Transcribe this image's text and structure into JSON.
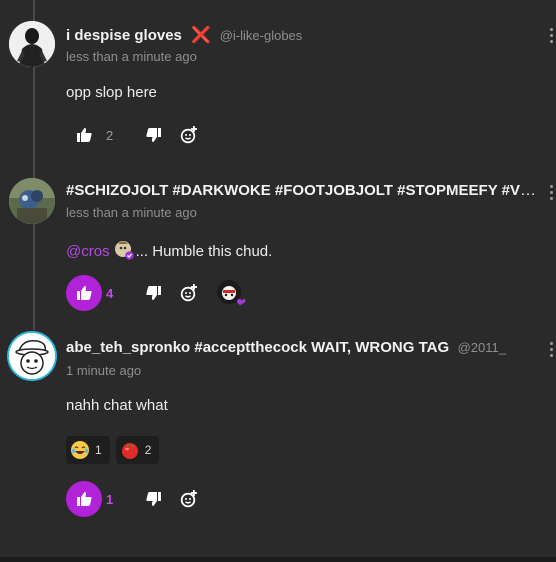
{
  "comments": [
    {
      "display_name": "i despise gloves",
      "badge": "❌",
      "handle": "@i-like-globes",
      "time": "less than a minute ago",
      "text": "opp slop here",
      "like_count": "2",
      "liked": false
    },
    {
      "display_name": "#SCHIZOJOLT #DARKWOKE #FOOTJOBJOLT #STOPMEEFY #VOIDGRASSCAMPAIGN",
      "time": "less than a minute ago",
      "mention": "@cros",
      "text": "... Humble this chud.",
      "like_count": "4",
      "liked": true
    },
    {
      "display_name": "abe_teh_spronko #acceptthecock WAIT, WRONG TAG",
      "handle": "@2011_",
      "time": "1 minute ago",
      "text": "nahh chat what",
      "reactions": [
        {
          "emoji": "😂",
          "count": "1"
        },
        {
          "emoji": "🍅",
          "count": "2"
        }
      ],
      "like_count": "1",
      "liked": true
    }
  ],
  "icons": {
    "like": "thumbs-up-icon",
    "dislike": "thumbs-down-icon",
    "add_reaction": "add-reaction-icon",
    "menu": "kebab-menu-icon"
  },
  "colors": {
    "accent": "#b023d8",
    "background": "#2a2a2a",
    "badge_red": "#e02424"
  }
}
